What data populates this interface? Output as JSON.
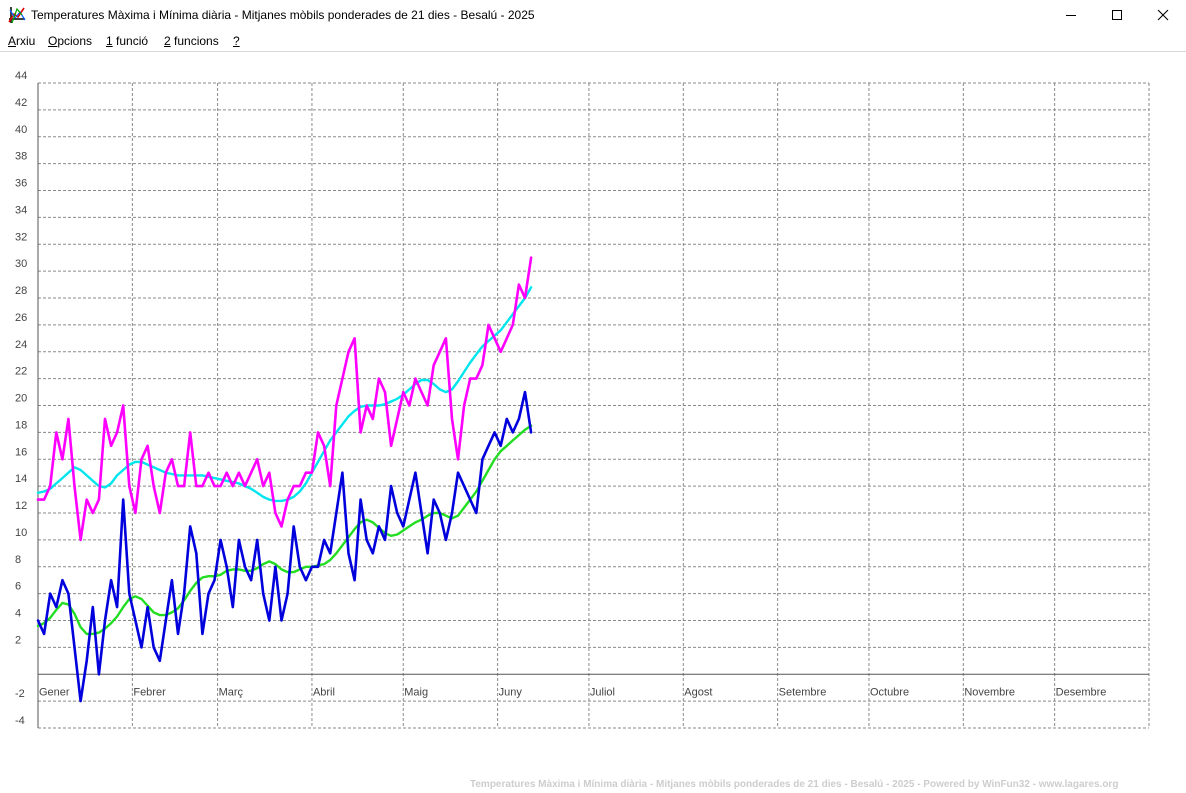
{
  "window": {
    "title": "Temperatures Màxima i Mínima diària - Mitjanes mòbils ponderades de 21 dies - Besalú - 2025"
  },
  "menu": {
    "items": [
      {
        "label": "Arxiu",
        "key": "A"
      },
      {
        "label": "Opcions",
        "key": "O"
      },
      {
        "label": "1 funció",
        "key": "1"
      },
      {
        "label": "2 funcions",
        "key": "2"
      },
      {
        "label": "?",
        "key": "?"
      }
    ]
  },
  "footer": {
    "text": "Temperatures Màxima i Mínima diària - Mitjanes mòbils ponderades de 21 dies - Besalú - 2025 - Powered by WinFun32 - www.lagares.org"
  },
  "icons": {
    "app": "chart-axes-icon",
    "minimize": "minimize-icon",
    "maximize": "maximize-icon",
    "close": "close-icon"
  },
  "chart_data": {
    "type": "line",
    "title": "Temperatures Màxima i Mínima diària - Mitjanes mòbils ponderades de 21 dies - Besalú - 2025",
    "xlabel": "",
    "ylabel": "",
    "ylim": [
      -4,
      44
    ],
    "xlim": [
      0,
      365
    ],
    "y_ticks": [
      -4,
      -2,
      2,
      4,
      6,
      8,
      10,
      12,
      14,
      16,
      18,
      20,
      22,
      24,
      26,
      28,
      30,
      32,
      34,
      36,
      38,
      40,
      42,
      44
    ],
    "x_tick_days": [
      0,
      31,
      59,
      90,
      120,
      151,
      181,
      212,
      243,
      273,
      304,
      334
    ],
    "categories": [
      "Gener",
      "Febrer",
      "Març",
      "Abril",
      "Maig",
      "Juny",
      "Juliol",
      "Agost",
      "Setembre",
      "Octubre",
      "Novembre",
      "Desembre"
    ],
    "grid": true,
    "colors": {
      "max": "#ff00ff",
      "max_avg": "#00e5ee",
      "min": "#0000dd",
      "min_avg": "#22dd22",
      "grid": "#8a8a8a",
      "axis": "#555555"
    },
    "series": [
      {
        "key": "max",
        "x": [
          0,
          2,
          4,
          6,
          8,
          10,
          12,
          14,
          16,
          18,
          20,
          22,
          24,
          26,
          28,
          30,
          32,
          34,
          36,
          38,
          40,
          42,
          44,
          46,
          48,
          50,
          52,
          54,
          56,
          58,
          60,
          62,
          64,
          66,
          68,
          70,
          72,
          74,
          76,
          78,
          80,
          82,
          84,
          86,
          88,
          90,
          92,
          94,
          96,
          98,
          100,
          102,
          104,
          106,
          108,
          110,
          112,
          114,
          116,
          118,
          120,
          122,
          124,
          126,
          128,
          130,
          132,
          134,
          136,
          138,
          140,
          142,
          144,
          146,
          148,
          150,
          152,
          154,
          156,
          158,
          160,
          162
        ],
        "y": [
          13,
          13,
          14,
          18,
          16,
          19,
          14,
          10,
          13,
          12,
          13,
          19,
          17,
          18,
          20,
          14,
          12,
          16,
          17,
          14,
          12,
          15,
          16,
          14,
          14,
          18,
          14,
          14,
          15,
          14,
          14,
          15,
          14,
          15,
          14,
          15,
          16,
          14,
          15,
          12,
          11,
          13,
          14,
          14,
          15,
          15,
          18,
          17,
          14,
          20,
          22,
          24,
          25,
          18,
          20,
          19,
          22,
          21,
          17,
          19,
          21,
          20,
          22,
          21,
          20,
          23,
          24,
          25,
          19,
          16,
          20,
          22,
          22,
          23,
          26,
          25,
          24,
          25,
          26,
          29,
          28,
          31
        ]
      },
      {
        "key": "max_avg",
        "x": [
          0,
          2,
          4,
          6,
          8,
          10,
          12,
          14,
          16,
          18,
          20,
          22,
          24,
          26,
          28,
          30,
          32,
          34,
          36,
          38,
          40,
          42,
          44,
          46,
          48,
          50,
          52,
          54,
          56,
          58,
          60,
          62,
          64,
          66,
          68,
          70,
          72,
          74,
          76,
          78,
          80,
          82,
          84,
          86,
          88,
          90,
          92,
          94,
          96,
          98,
          100,
          102,
          104,
          106,
          108,
          110,
          112,
          114,
          116,
          118,
          120,
          122,
          124,
          126,
          128,
          130,
          132,
          134,
          136,
          138,
          140,
          142,
          144,
          146,
          148,
          150,
          152,
          154,
          156,
          158,
          160,
          162
        ],
        "y": [
          13.5,
          13.6,
          13.8,
          14.2,
          14.6,
          15.0,
          15.4,
          15.2,
          14.8,
          14.4,
          14.0,
          13.9,
          14.2,
          14.8,
          15.2,
          15.6,
          15.8,
          15.8,
          15.6,
          15.4,
          15.2,
          15.0,
          14.9,
          14.8,
          14.8,
          14.8,
          14.8,
          14.8,
          14.7,
          14.6,
          14.5,
          14.4,
          14.3,
          14.2,
          14.0,
          13.8,
          13.5,
          13.2,
          13.0,
          12.9,
          12.9,
          13.0,
          13.2,
          13.6,
          14.2,
          15.0,
          15.8,
          16.6,
          17.4,
          18.0,
          18.6,
          19.2,
          19.6,
          19.9,
          20.0,
          20.0,
          20.0,
          20.1,
          20.3,
          20.5,
          20.8,
          21.2,
          21.6,
          21.9,
          21.9,
          21.6,
          21.2,
          21.0,
          21.2,
          21.8,
          22.5,
          23.2,
          23.8,
          24.4,
          24.8,
          25.2,
          25.6,
          26.2,
          26.8,
          27.4,
          28.0,
          28.8
        ]
      },
      {
        "key": "min",
        "x": [
          0,
          2,
          4,
          6,
          8,
          10,
          12,
          14,
          16,
          18,
          20,
          22,
          24,
          26,
          28,
          30,
          32,
          34,
          36,
          38,
          40,
          42,
          44,
          46,
          48,
          50,
          52,
          54,
          56,
          58,
          60,
          62,
          64,
          66,
          68,
          70,
          72,
          74,
          76,
          78,
          80,
          82,
          84,
          86,
          88,
          90,
          92,
          94,
          96,
          98,
          100,
          102,
          104,
          106,
          108,
          110,
          112,
          114,
          116,
          118,
          120,
          122,
          124,
          126,
          128,
          130,
          132,
          134,
          136,
          138,
          140,
          142,
          144,
          146,
          148,
          150,
          152,
          154,
          156,
          158,
          160,
          162
        ],
        "y": [
          4,
          3,
          6,
          5,
          7,
          6,
          2,
          -2,
          1,
          5,
          0,
          4,
          7,
          5,
          13,
          6,
          4,
          2,
          5,
          2,
          1,
          4,
          7,
          3,
          6,
          11,
          9,
          3,
          6,
          7,
          10,
          8,
          5,
          10,
          8,
          7,
          10,
          6,
          4,
          8,
          4,
          6,
          11,
          8,
          7,
          8,
          8,
          10,
          9,
          12,
          15,
          9,
          7,
          13,
          10,
          9,
          11,
          10,
          14,
          12,
          11,
          13,
          15,
          12,
          9,
          13,
          12,
          10,
          12,
          15,
          14,
          13,
          12,
          16,
          17,
          18,
          17,
          19,
          18,
          19,
          21,
          18
        ]
      },
      {
        "key": "min_avg",
        "x": [
          0,
          2,
          4,
          6,
          8,
          10,
          12,
          14,
          16,
          18,
          20,
          22,
          24,
          26,
          28,
          30,
          32,
          34,
          36,
          38,
          40,
          42,
          44,
          46,
          48,
          50,
          52,
          54,
          56,
          58,
          60,
          62,
          64,
          66,
          68,
          70,
          72,
          74,
          76,
          78,
          80,
          82,
          84,
          86,
          88,
          90,
          92,
          94,
          96,
          98,
          100,
          102,
          104,
          106,
          108,
          110,
          112,
          114,
          116,
          118,
          120,
          122,
          124,
          126,
          128,
          130,
          132,
          134,
          136,
          138,
          140,
          142,
          144,
          146,
          148,
          150,
          152,
          154,
          156,
          158,
          160,
          162
        ],
        "y": [
          3.6,
          3.8,
          4.2,
          4.8,
          5.3,
          5.2,
          4.5,
          3.5,
          3.0,
          3.0,
          3.1,
          3.4,
          3.8,
          4.3,
          5.0,
          5.6,
          5.8,
          5.6,
          5.1,
          4.6,
          4.4,
          4.4,
          4.6,
          4.9,
          5.5,
          6.2,
          6.8,
          7.2,
          7.3,
          7.3,
          7.4,
          7.7,
          7.8,
          7.8,
          7.7,
          7.7,
          7.9,
          8.2,
          8.4,
          8.2,
          7.8,
          7.6,
          7.6,
          7.8,
          8.0,
          8.0,
          8.1,
          8.2,
          8.5,
          9.0,
          9.6,
          10.2,
          10.8,
          11.3,
          11.5,
          11.3,
          10.9,
          10.5,
          10.3,
          10.4,
          10.7,
          11.0,
          11.3,
          11.5,
          11.8,
          12.0,
          12.0,
          11.8,
          11.6,
          11.8,
          12.4,
          13.0,
          13.6,
          14.4,
          15.2,
          16.0,
          16.6,
          17.0,
          17.4,
          17.8,
          18.2,
          18.5
        ]
      }
    ]
  }
}
